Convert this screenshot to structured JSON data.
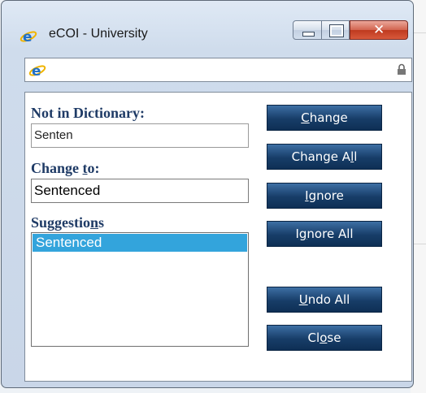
{
  "window": {
    "title": "eCOI - University"
  },
  "icons": {
    "app": "ie-icon",
    "address": "ie-icon",
    "lock": "lock-icon"
  },
  "spell": {
    "not_in_dictionary_label": "Not in Dictionary:",
    "not_in_dictionary_value": "Senten",
    "change_to_label": "Change to:",
    "change_to_value": "Sentenced",
    "suggestions_label": "Suggestions",
    "suggestions": [
      "Sentenced"
    ],
    "selected_suggestion": "Sentenced"
  },
  "buttons": {
    "change": "Change",
    "change_all": "Change All",
    "ignore": "Ignore",
    "ignore_all": "Ignore All",
    "undo_all": "Undo All",
    "close": "Close"
  },
  "colors": {
    "label": "#1f3b66",
    "button": "#173d68",
    "selection": "#33a4dc"
  }
}
